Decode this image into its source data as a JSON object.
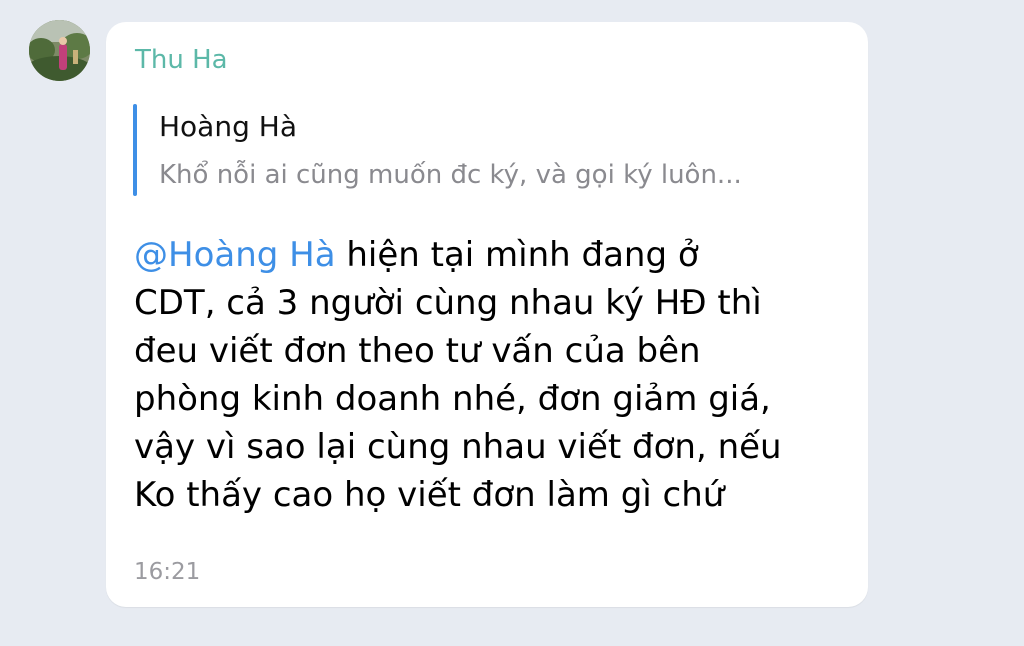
{
  "message": {
    "sender": "Thu Ha",
    "avatar_icon": "profile-photo",
    "reply": {
      "author": "Hoàng Hà",
      "snippet": "Khổ nỗi ai cũng muốn đc ký, và gọi ký luôn..."
    },
    "mention": "@Hoàng Hà",
    "lines": [
      " hiện tại mình đang ở",
      "CDT, cả 3 người cùng nhau ký HĐ thì",
      "đeu viết đơn theo tư vấn của bên",
      "phòng kinh doanh nhé, đơn giảm giá,",
      "vậy vì sao lại cùng nhau viết đơn, nếu",
      "Ko thấy cao họ viết đơn làm gì chứ"
    ],
    "time": "16:21"
  },
  "colors": {
    "background": "#e7ebf2",
    "bubble": "#ffffff",
    "sender_name": "#5cb8a8",
    "accent": "#3e8fe6",
    "secondary_text": "#8a8a8f"
  }
}
